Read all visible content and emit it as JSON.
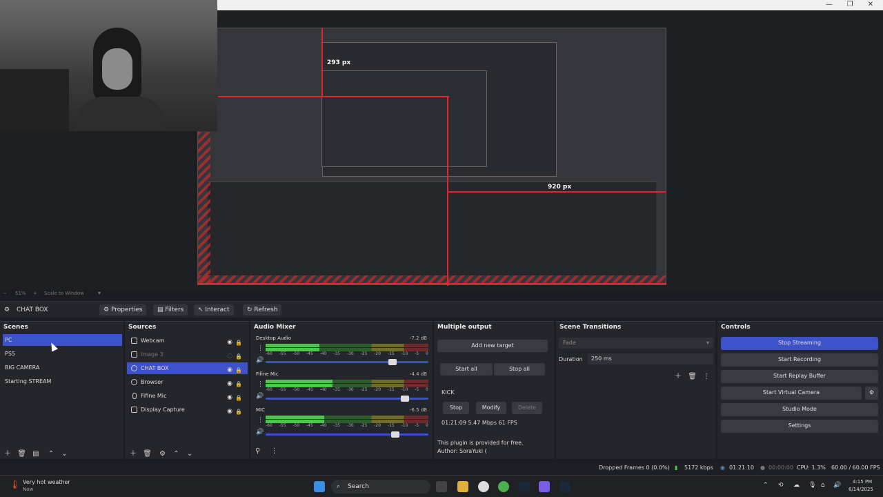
{
  "window": {
    "minimize": "—",
    "maximize": "❐",
    "close": "✕"
  },
  "preview": {
    "label_293": "293 px",
    "label_920": "920 px"
  },
  "zoom": {
    "value": "51%",
    "scale": "Scale to Window"
  },
  "source_toolbar": {
    "current_source": "CHAT BOX",
    "properties": "Properties",
    "filters": "Filters",
    "interact": "Interact",
    "refresh": "Refresh"
  },
  "scenes": {
    "title": "Scenes",
    "items": [
      "PC",
      "PS5",
      "BIG CAMERA",
      "Starting STREAM"
    ]
  },
  "sources": {
    "title": "Sources",
    "items": [
      "Webcam",
      "Image 3",
      "CHAT BOX",
      "Browser",
      "Fifine Mic",
      "Display Capture"
    ]
  },
  "mixer": {
    "title": "Audio Mixer",
    "channels": [
      {
        "name": "Desktop Audio",
        "db": "-7.2 dB",
        "level": 0.33
      },
      {
        "name": "Fifine Mic",
        "db": "-4.4 dB",
        "level": 0.41
      },
      {
        "name": "MIC",
        "db": "-6.5 dB",
        "level": 0.36
      }
    ],
    "ticks": [
      "-60",
      "-55",
      "-50",
      "-45",
      "-40",
      "-35",
      "-30",
      "-25",
      "-20",
      "-15",
      "-10",
      "-5",
      "0"
    ]
  },
  "multiple_output": {
    "title": "Multiple output",
    "add_new_target": "Add new target",
    "start_all": "Start all",
    "stop_all": "Stop all",
    "target_name": "KICK",
    "stop": "Stop",
    "modify": "Modify",
    "delete": "Delete",
    "stats": "01:21:09  5.47 Mbps  61 FPS",
    "plugin_note": "This plugin is provided for free.",
    "author": "Author: SoraYuki ("
  },
  "transitions": {
    "title": "Scene Transitions",
    "selected": "Fade",
    "duration_label": "Duration",
    "duration_value": "250 ms"
  },
  "controls": {
    "title": "Controls",
    "stop_streaming": "Stop Streaming",
    "start_recording": "Start Recording",
    "start_replay_buffer": "Start Replay Buffer",
    "start_virtual_camera": "Start Virtual Camera",
    "studio_mode": "Studio Mode",
    "settings": "Settings"
  },
  "status": {
    "dropped_frames": "Dropped Frames 0 (0.0%)",
    "bitrate": "5172 kbps",
    "stream_time": "01:21:10",
    "rec_time": "00:00:00",
    "cpu": "CPU: 1.3%",
    "fps": "60.00 / 60.00 FPS"
  },
  "taskbar": {
    "weather_title": "Very hot weather",
    "weather_sub": "Now",
    "search": "Search",
    "time": "4:15 PM",
    "date": "8/14/2025"
  },
  "colors": {
    "accent": "#3d52c9",
    "guide_red": "#e2262c"
  }
}
